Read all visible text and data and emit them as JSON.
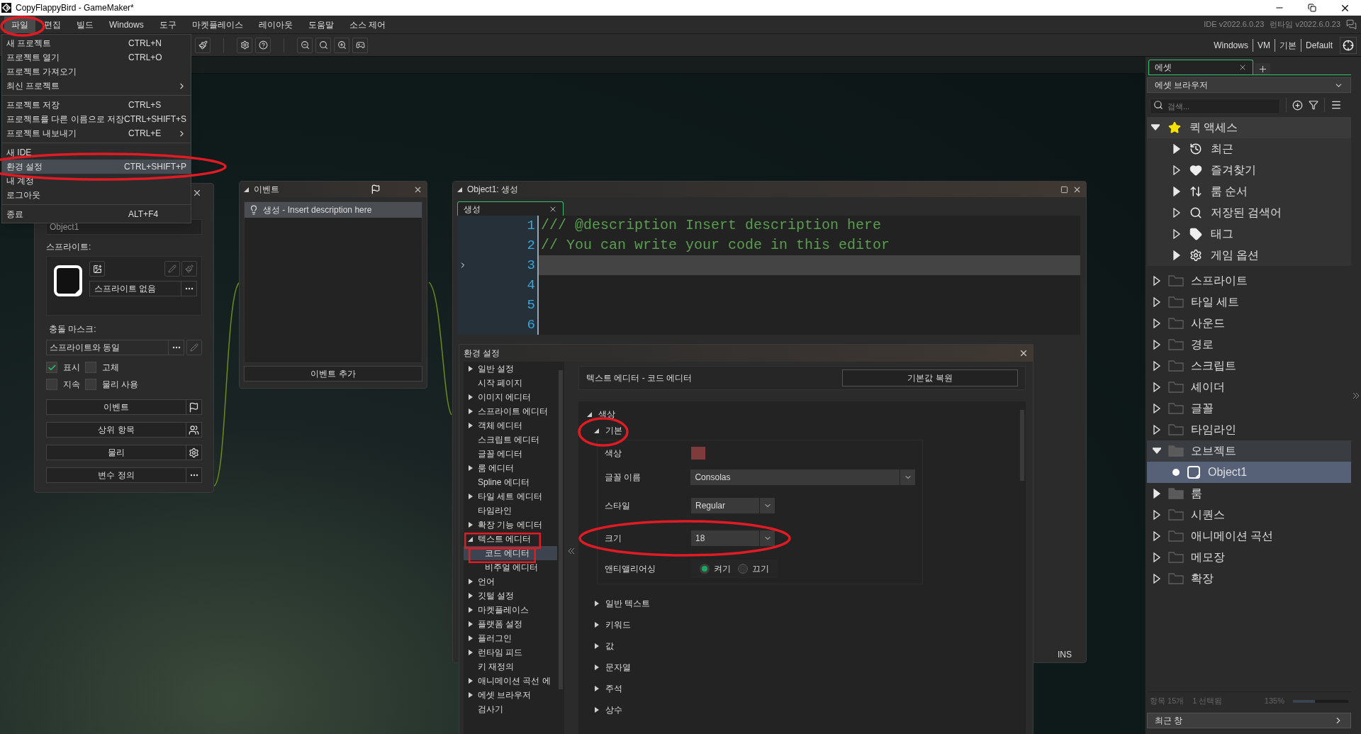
{
  "window": {
    "title": "CopyFlappyBird - GameMaker*"
  },
  "menu": [
    {
      "label": "파일",
      "selected": true
    },
    {
      "label": "편집",
      "selected": false
    },
    {
      "label": "빌드",
      "selected": false
    },
    {
      "label": "Windows",
      "selected": false
    },
    {
      "label": "도구",
      "selected": false
    },
    {
      "label": "마켓플레이스",
      "selected": false
    },
    {
      "label": "레이아웃",
      "selected": false
    },
    {
      "label": "도움말",
      "selected": false
    },
    {
      "label": "소스 제어",
      "selected": false
    }
  ],
  "version": {
    "ide": "IDE v2022.6.0.23",
    "runtime": "런타임 v2022.6.0.23"
  },
  "target_bar": [
    "Windows",
    "VM",
    "기본",
    "Default"
  ],
  "file_menu": [
    [
      {
        "label": "새 프로젝트",
        "shortcut": "CTRL+N",
        "submenu": false,
        "selected": false
      },
      {
        "label": "프로젝트 열기",
        "shortcut": "CTRL+O",
        "submenu": false,
        "selected": false
      },
      {
        "label": "프로젝트 가져오기",
        "submenu": false,
        "selected": false
      },
      {
        "label": "최신 프로젝트",
        "submenu": true,
        "selected": false
      }
    ],
    [
      {
        "label": "프로젝트 저장",
        "shortcut": "CTRL+S",
        "submenu": false,
        "selected": false
      },
      {
        "label": "프로젝트를 다른 이름으로 저장",
        "shortcut": "CTRL+SHIFT+S",
        "submenu": false,
        "selected": false
      },
      {
        "label": "프로젝트 내보내기",
        "shortcut": "CTRL+E",
        "submenu": true,
        "selected": false
      }
    ],
    [
      {
        "label": "새 IDE",
        "submenu": false,
        "selected": false
      },
      {
        "label": "환경 설정",
        "shortcut": "CTRL+SHIFT+P",
        "submenu": false,
        "selected": true
      },
      {
        "label": "내 계정",
        "submenu": false,
        "selected": false
      },
      {
        "label": "로그아웃",
        "submenu": false,
        "selected": false
      }
    ],
    [
      {
        "label": "종료",
        "shortcut": "ALT+F4",
        "submenu": false,
        "selected": false
      }
    ]
  ],
  "object_panel": {
    "name": "Object1",
    "sprite_label": "스프라이트:",
    "sprite_value": "스프라이트 없음",
    "mask_label": "충돌 마스크:",
    "mask_value": "스프라이트와 동일",
    "checkboxes": [
      {
        "label": "표시",
        "checked": true
      },
      {
        "label": "고체",
        "checked": false
      },
      {
        "label": "지속",
        "checked": false
      },
      {
        "label": "물리 사용",
        "checked": false
      }
    ],
    "buttons": [
      {
        "label": "이벤트",
        "kind": "flag"
      },
      {
        "label": "상위 항목",
        "kind": "parent"
      },
      {
        "label": "물리",
        "kind": "gear"
      },
      {
        "label": "변수 정의",
        "kind": "more"
      }
    ]
  },
  "events_window": {
    "title": "이벤트",
    "events": [
      {
        "label": "생성 - Insert description here",
        "selected": true
      }
    ],
    "add_button": "이벤트 추가"
  },
  "code_editor": {
    "title": "Object1: 생성",
    "tab": "생성",
    "lines": [
      {
        "number": "1",
        "code": "/// @description Insert description here",
        "current": false
      },
      {
        "number": "2",
        "code": "// You can write your code in this editor",
        "current": false
      },
      {
        "number": "3",
        "current": true
      },
      {
        "number": "4",
        "current": false
      },
      {
        "number": "5",
        "current": false
      },
      {
        "number": "6",
        "current": false
      }
    ],
    "status": "INS"
  },
  "preferences": {
    "title": "환경 설정",
    "tree": [
      {
        "label": "일반 설정",
        "expandable": true,
        "expanded": false
      },
      {
        "label": "시작 페이지",
        "expandable": false
      },
      {
        "label": "이미지 에디터",
        "expandable": true,
        "expanded": false
      },
      {
        "label": "스프라이트 에디터",
        "expandable": true,
        "expanded": false
      },
      {
        "label": "객체 에디터",
        "expandable": true,
        "expanded": false
      },
      {
        "label": "스크립트 에디터",
        "expandable": false
      },
      {
        "label": "글꼴 에디터",
        "expandable": false
      },
      {
        "label": "룸 에디터",
        "expandable": true,
        "expanded": false
      },
      {
        "label": "Spline 에디터",
        "expandable": false
      },
      {
        "label": "타일 세트 에디터",
        "expandable": true,
        "expanded": false
      },
      {
        "label": "타임라인",
        "expandable": false
      },
      {
        "label": "확장 기능 에디터",
        "expandable": true,
        "expanded": false
      },
      {
        "label": "텍스트 에디터",
        "expandable": true,
        "expanded": true,
        "children": [
          {
            "label": "코드 에디터",
            "selected": true
          },
          {
            "label": "비주얼 에디터",
            "selected": false
          }
        ]
      },
      {
        "label": "언어",
        "expandable": true,
        "expanded": false
      },
      {
        "label": "깃털 설정",
        "expandable": true,
        "expanded": false
      },
      {
        "label": "마켓플레이스",
        "expandable": true,
        "expanded": false
      },
      {
        "label": "플랫폼 설정",
        "expandable": true,
        "expanded": false
      },
      {
        "label": "플러그인",
        "expandable": true,
        "expanded": false
      },
      {
        "label": "런타임 피드",
        "expandable": true,
        "expanded": false
      },
      {
        "label": "키 재정의",
        "expandable": false
      },
      {
        "label": "애니메이션 곡선 에",
        "expandable": true,
        "expanded": false
      },
      {
        "label": "에셋 브라우저",
        "expandable": true,
        "expanded": false
      },
      {
        "label": "검사기",
        "expandable": false
      }
    ],
    "page_title": "텍스트 에디터 - 코드 에디터",
    "reset_button": "기본값 복원",
    "section": "색상",
    "subsection": "기본",
    "color_label": "색상",
    "color": "#7f3b3b",
    "font_label": "글꼴 이름",
    "font_value": "Consolas",
    "style_label": "스타일",
    "style_value": "Regular",
    "size_label": "크기",
    "size_value": "18",
    "antialias_label": "앤티앨리어싱",
    "antialias_options": [
      {
        "label": "켜기",
        "selected": true
      },
      {
        "label": "끄기",
        "selected": false
      }
    ],
    "collapsed_sections": [
      "일반 텍스트",
      "키워드",
      "값",
      "문자열",
      "주석",
      "상수"
    ]
  },
  "assets": {
    "tab": "에셋",
    "view": "에셋 브라우저",
    "search": {
      "placeholder": "검색..."
    },
    "quick_access": {
      "label": "퀵 액세스",
      "expanded": true,
      "items": [
        {
          "label": "최근",
          "kind": "recent",
          "has_items": true
        },
        {
          "label": "즐겨찾기",
          "kind": "favorites",
          "has_items": false
        },
        {
          "label": "룸 순서",
          "kind": "room-order",
          "has_items": true
        },
        {
          "label": "저장된 검색어",
          "kind": "search",
          "has_items": false
        },
        {
          "label": "태그",
          "kind": "tag",
          "has_items": false
        },
        {
          "label": "게임 옵션",
          "kind": "options",
          "has_items": true
        }
      ]
    },
    "folders": [
      {
        "label": "스프라이트",
        "has_items": false,
        "expanded": false
      },
      {
        "label": "타일 세트",
        "has_items": false,
        "expanded": false
      },
      {
        "label": "사운드",
        "has_items": false,
        "expanded": false
      },
      {
        "label": "경로",
        "has_items": false,
        "expanded": false
      },
      {
        "label": "스크립트",
        "has_items": false,
        "expanded": false
      },
      {
        "label": "셰이더",
        "has_items": false,
        "expanded": false
      },
      {
        "label": "글꼴",
        "has_items": false,
        "expanded": false
      },
      {
        "label": "타임라인",
        "has_items": false,
        "expanded": false
      },
      {
        "label": "오브젝트",
        "has_items": true,
        "expanded": true,
        "children": [
          {
            "label": "Object1",
            "selected": true
          }
        ]
      },
      {
        "label": "룸",
        "has_items": true,
        "expanded": false
      },
      {
        "label": "시퀀스",
        "has_items": false,
        "expanded": false
      },
      {
        "label": "애니메이션 곡선",
        "has_items": false,
        "expanded": false
      },
      {
        "label": "메모장",
        "has_items": false,
        "expanded": false
      },
      {
        "label": "확장",
        "has_items": false,
        "expanded": false
      }
    ],
    "count": "항목 15개",
    "selection": "1 선택됨",
    "zoom": "135%",
    "zoom_slider": {
      "level": 0.4
    },
    "recent_windows": "최근 창"
  }
}
